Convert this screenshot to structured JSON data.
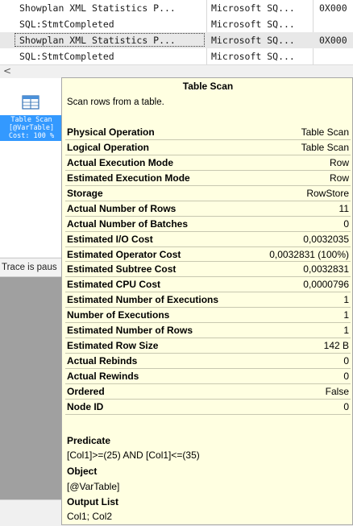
{
  "events": {
    "rows": [
      {
        "event": "Showplan XML Statistics P...",
        "app": "Microsoft SQ...",
        "data": "0X000"
      },
      {
        "event": "SQL:StmtCompleted",
        "app": "Microsoft SQ...",
        "data": ""
      },
      {
        "event": "Showplan XML Statistics P...",
        "app": "Microsoft SQ...",
        "data": "0X000"
      },
      {
        "event": "SQL:StmtCompleted",
        "app": "Microsoft SQ...",
        "data": ""
      }
    ]
  },
  "scrollbar": {
    "left_arrow": "<"
  },
  "plan": {
    "operator_label": [
      "Table Scan",
      "[@VarTable]",
      "Cost: 100 %"
    ],
    "operator_icon": "table-scan-icon"
  },
  "status": {
    "trace_text": "Trace is paus"
  },
  "tooltip": {
    "title": "Table Scan",
    "description": "Scan rows from a table.",
    "properties": [
      {
        "key": "Physical Operation",
        "value": "Table Scan"
      },
      {
        "key": "Logical Operation",
        "value": "Table Scan"
      },
      {
        "key": "Actual Execution Mode",
        "value": "Row"
      },
      {
        "key": "Estimated Execution Mode",
        "value": "Row"
      },
      {
        "key": "Storage",
        "value": "RowStore"
      },
      {
        "key": "Actual Number of Rows",
        "value": "11"
      },
      {
        "key": "Actual Number of Batches",
        "value": "0"
      },
      {
        "key": "Estimated I/O Cost",
        "value": "0,0032035"
      },
      {
        "key": "Estimated Operator Cost",
        "value": "0,0032831 (100%)"
      },
      {
        "key": "Estimated Subtree Cost",
        "value": "0,0032831"
      },
      {
        "key": "Estimated CPU Cost",
        "value": "0,0000796"
      },
      {
        "key": "Estimated Number of Executions",
        "value": "1"
      },
      {
        "key": "Number of Executions",
        "value": "1"
      },
      {
        "key": "Estimated Number of Rows",
        "value": "1"
      },
      {
        "key": "Estimated Row Size",
        "value": "142 B"
      },
      {
        "key": "Actual Rebinds",
        "value": "0"
      },
      {
        "key": "Actual Rewinds",
        "value": "0"
      },
      {
        "key": "Ordered",
        "value": "False"
      },
      {
        "key": "Node ID",
        "value": "0"
      }
    ],
    "predicate_label": "Predicate",
    "predicate_value": "[Col1]>=(25) AND [Col1]<=(35)",
    "object_label": "Object",
    "object_value": "[@VarTable]",
    "output_label": "Output List",
    "output_value": "Col1; Col2"
  },
  "colors": {
    "tooltip_bg": "#ffffe1",
    "selection": "#3399ff"
  }
}
